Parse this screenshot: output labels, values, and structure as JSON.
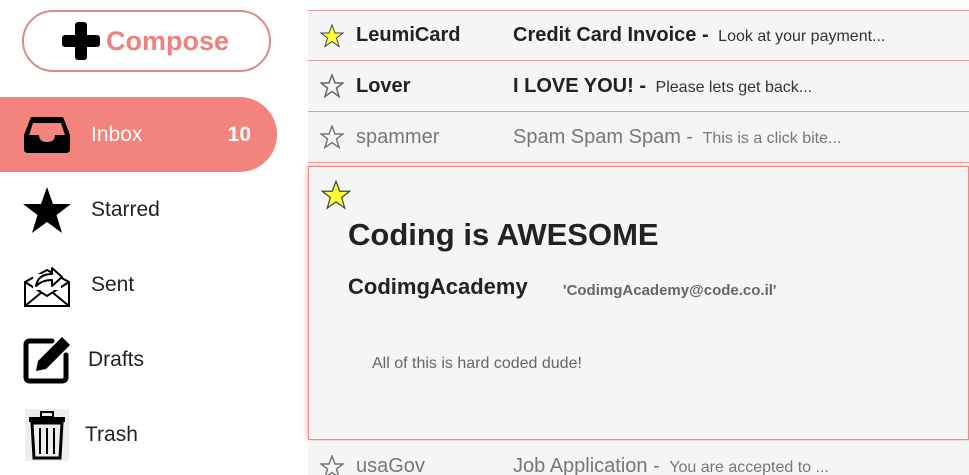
{
  "sidebar": {
    "compose_label": "Compose",
    "items": [
      {
        "label": "Inbox",
        "count": "10",
        "icon": "inbox-icon"
      },
      {
        "label": "Starred",
        "icon": "star-icon"
      },
      {
        "label": "Sent",
        "icon": "sent-icon"
      },
      {
        "label": "Drafts",
        "icon": "drafts-icon"
      },
      {
        "label": "Trash",
        "icon": "trash-icon"
      }
    ]
  },
  "emails": [
    {
      "sender": "LeumiCard",
      "subject": "Credit Card Invoice",
      "separator": " - ",
      "snippet": "Look at your payment...",
      "starred": true,
      "read": false
    },
    {
      "sender": "Lover",
      "subject": "I LOVE YOU!",
      "separator": " - ",
      "snippet": "Please lets get back...",
      "starred": false,
      "read": false
    },
    {
      "sender": "spammer",
      "subject": "Spam Spam Spam",
      "separator": " - ",
      "snippet": "This is a click bite...",
      "starred": false,
      "read": true
    },
    {
      "sender": "usaGov",
      "subject": "Job Application",
      "separator": " - ",
      "snippet": "You are accepted to ...",
      "starred": false,
      "read": true
    }
  ],
  "preview": {
    "title": "Coding is AWESOME",
    "from_name": "CodimgAcademy",
    "from_email": "'CodimgAcademy@code.co.il'",
    "body": "All of this is hard coded dude!",
    "starred": true
  },
  "colors": {
    "accent": "#f3837d",
    "compose_text": "#f08080",
    "star_yellow": "#ffff33",
    "border": "#e0a0a0"
  }
}
